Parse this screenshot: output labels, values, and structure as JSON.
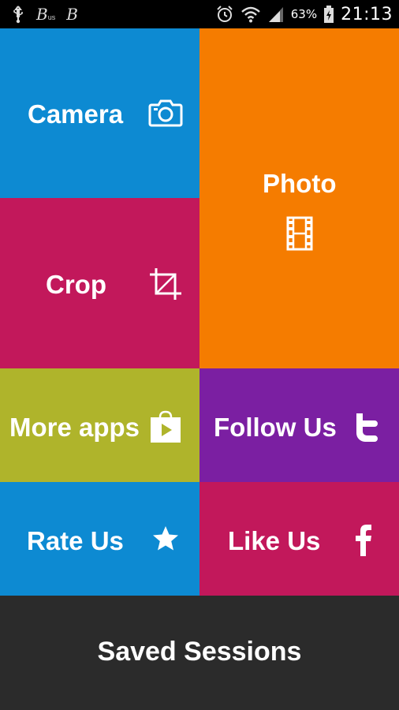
{
  "status_bar": {
    "battery_percent": "63%",
    "time": "21:13",
    "icons": [
      "usb-icon",
      "b-icon",
      "b-us-icon",
      "alarm-icon",
      "wifi-icon",
      "signal-icon",
      "battery-charging-icon"
    ],
    "notif_b1": "B",
    "notif_b1_sub": "us",
    "notif_b2": "B"
  },
  "tiles": {
    "camera": {
      "label": "Camera",
      "color": "#0d8ad2",
      "icon": "camera-icon"
    },
    "photo": {
      "label": "Photo",
      "color": "#f57c00",
      "icon": "film-strip-icon"
    },
    "crop": {
      "label": "Crop",
      "color": "#c2185b",
      "icon": "crop-icon"
    },
    "more_apps": {
      "label": "More apps",
      "color": "#afb42b",
      "icon": "play-store-bag-icon"
    },
    "follow_us": {
      "label": "Follow Us",
      "color": "#7b1fa2",
      "icon": "twitter-icon"
    },
    "rate_us": {
      "label": "Rate Us",
      "color": "#0d8ad2",
      "icon": "star-icon"
    },
    "like_us": {
      "label": "Like Us",
      "color": "#c2185b",
      "icon": "facebook-icon"
    }
  },
  "saved_sessions": {
    "label": "Saved Sessions",
    "color": "#2b2b2b"
  }
}
